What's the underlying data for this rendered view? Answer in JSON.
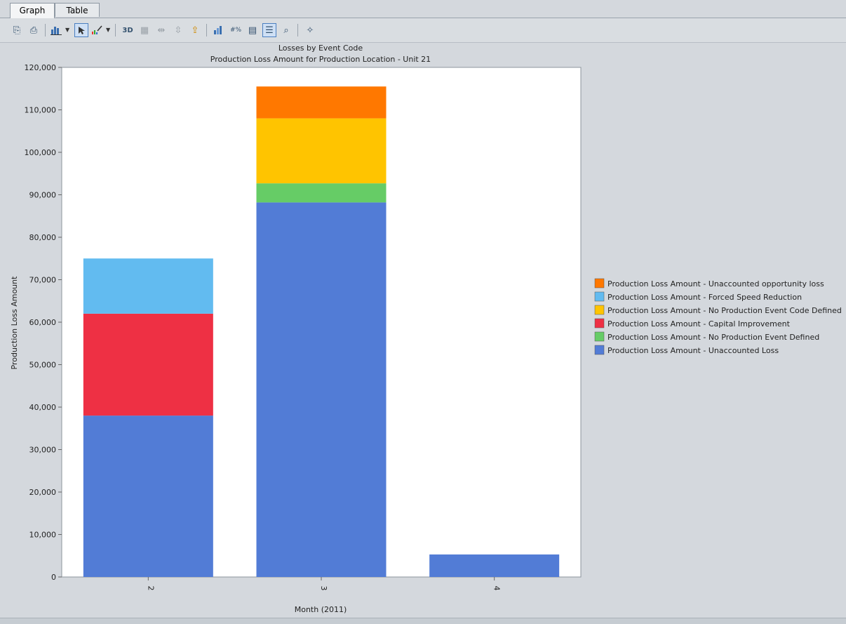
{
  "tabs": [
    {
      "label": "Graph"
    },
    {
      "label": "Table"
    }
  ],
  "toolbar": {
    "buttons": [
      {
        "icon": "copy-icon"
      },
      {
        "icon": "print-icon"
      },
      {
        "icon": "chart-type-icon"
      },
      {
        "icon": "cursor-select-icon"
      },
      {
        "icon": "palette-icon"
      },
      {
        "icon": "3d-view-icon"
      },
      {
        "icon": "grid-icon"
      },
      {
        "icon": "rotate-horizontal-icon"
      },
      {
        "icon": "rotate-vertical-icon"
      },
      {
        "icon": "export-icon"
      },
      {
        "icon": "series-properties-icon"
      },
      {
        "icon": "point-labels-icon"
      },
      {
        "icon": "data-editor-icon"
      },
      {
        "icon": "legend-box-icon"
      },
      {
        "icon": "zoom-icon"
      },
      {
        "icon": "wizard-icon"
      }
    ]
  },
  "chart_data": {
    "type": "bar",
    "stacked": true,
    "title": "Losses by Event Code",
    "subtitle": "Production Loss Amount for Production Location - Unit 21",
    "xlabel": "Month (2011)",
    "ylabel": "Production Loss Amount",
    "categories": [
      "2",
      "3",
      "4"
    ],
    "ylim": [
      0,
      120000
    ],
    "yticks": [
      "0",
      "10,000",
      "20,000",
      "30,000",
      "40,000",
      "50,000",
      "60,000",
      "70,000",
      "80,000",
      "90,000",
      "100,000",
      "110,000",
      "120,000"
    ],
    "grid": false,
    "legend_position": "right",
    "series": [
      {
        "name": "Production Loss Amount - Unaccounted Loss",
        "color": "#527cd6",
        "values": [
          38000,
          88200,
          5300
        ]
      },
      {
        "name": "Production Loss Amount - No Production Event Defined",
        "color": "#66cc66",
        "values": [
          0,
          4500,
          0
        ]
      },
      {
        "name": "Production Loss Amount - Capital Improvement",
        "color": "#ee3044",
        "values": [
          24000,
          0,
          0
        ]
      },
      {
        "name": "Production Loss Amount - No Production Event Code Defined",
        "color": "#ffc400",
        "values": [
          0,
          15300,
          0
        ]
      },
      {
        "name": "Production Loss Amount - Forced Speed Reduction",
        "color": "#62bbf0",
        "values": [
          13000,
          0,
          0
        ]
      },
      {
        "name": "Production Loss Amount - Unaccounted opportunity loss",
        "color": "#ff7800",
        "values": [
          0,
          7500,
          0
        ]
      }
    ],
    "legend_order": [
      "Production Loss Amount - Unaccounted opportunity loss",
      "Production Loss Amount - Forced Speed Reduction",
      "Production Loss Amount - No Production Event Code Defined",
      "Production Loss Amount - Capital Improvement",
      "Production Loss Amount - No Production Event Defined",
      "Production Loss Amount - Unaccounted Loss"
    ]
  }
}
